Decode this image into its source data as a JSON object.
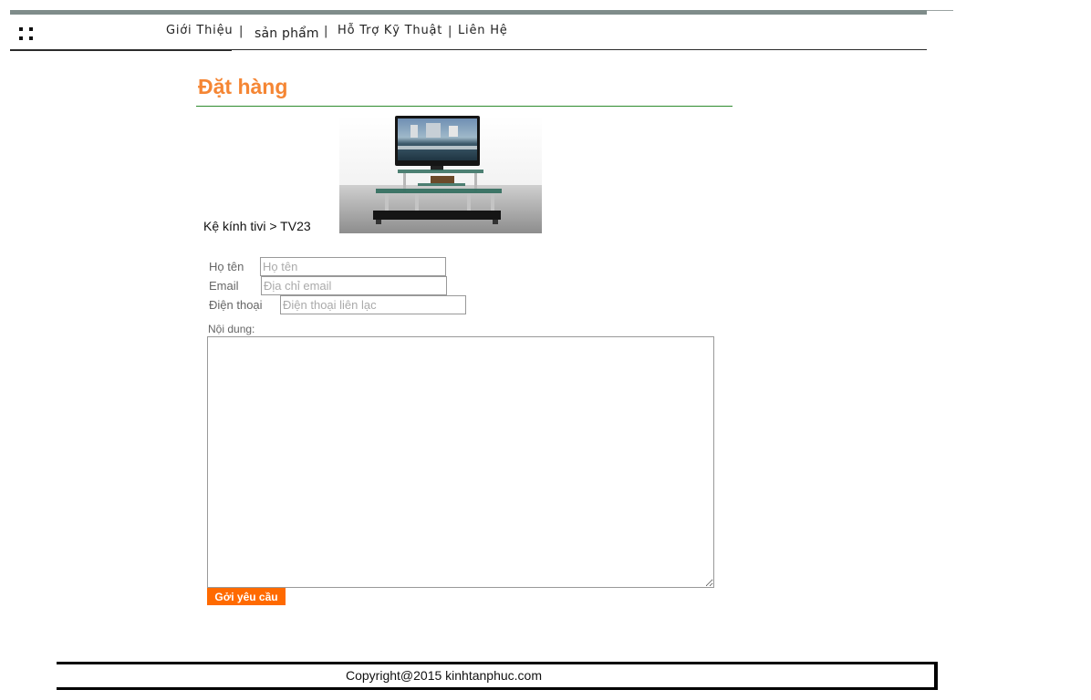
{
  "header": {
    "nav": [
      {
        "label": "Giới Thiệu"
      },
      {
        "label": "sản phẩm"
      },
      {
        "label": "Hỗ Trợ Kỹ Thuật"
      },
      {
        "label": "Liên Hệ"
      }
    ],
    "separator": "|"
  },
  "main": {
    "title": "Đặt hàng",
    "breadcrumb": "Kệ kính tivi > TV23",
    "product_image": "tv-stand-photo"
  },
  "form": {
    "name_label": "Họ tên",
    "name_placeholder": "Họ tên",
    "email_label": "Email",
    "email_placeholder": "Địa chỉ email",
    "phone_label": "Điện thoại",
    "phone_placeholder": "Điện thoại liên lạc",
    "content_label": "Nội dung:",
    "submit_label": "Gởi yêu cầu"
  },
  "footer": {
    "copyright": "Copyright@2015 kinhtanphuc.com"
  },
  "colors": {
    "accent": "#f58634",
    "button": "#ff6a00",
    "title_rule": "#2e8b2e",
    "topbar": "#7f8c8a"
  }
}
